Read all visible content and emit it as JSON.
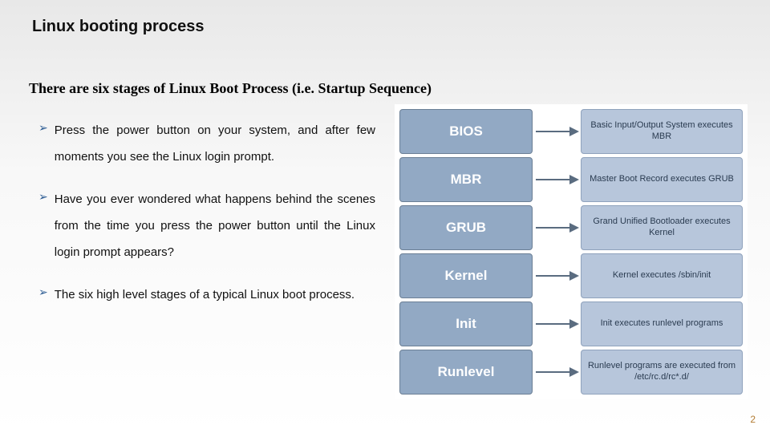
{
  "slide": {
    "title": "Linux booting process",
    "subtitle": "There are six stages of Linux Boot Process (i.e. Startup Sequence)",
    "page_number": "2"
  },
  "bullets": [
    "Press the power button on your system, and after few moments you see the Linux login prompt.",
    "Have you ever wondered what happens behind the scenes from the time you press the power button until the Linux login prompt appears?",
    "The six high level stages of a typical Linux boot process."
  ],
  "diagram": {
    "rows": [
      {
        "stage": "BIOS",
        "desc": "Basic Input/Output System executes MBR"
      },
      {
        "stage": "MBR",
        "desc": "Master Boot Record executes GRUB"
      },
      {
        "stage": "GRUB",
        "desc": "Grand Unified Bootloader executes Kernel"
      },
      {
        "stage": "Kernel",
        "desc": "Kernel executes /sbin/init"
      },
      {
        "stage": "Init",
        "desc": "Init executes runlevel programs"
      },
      {
        "stage": "Runlevel",
        "desc": "Runlevel programs are executed from /etc/rc.d/rc*.d/"
      }
    ]
  }
}
